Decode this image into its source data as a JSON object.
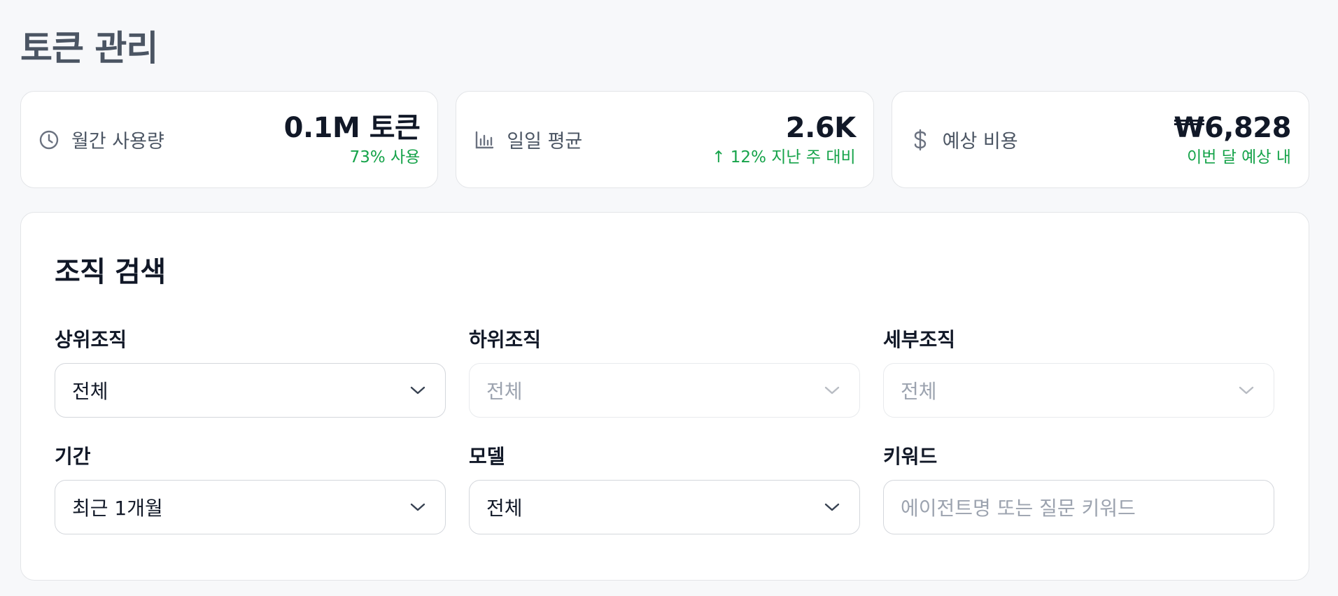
{
  "page": {
    "title": "토큰 관리"
  },
  "stats": [
    {
      "icon": "clock-icon",
      "label": "월간 사용량",
      "value": "0.1M 토큰",
      "sub": "73% 사용"
    },
    {
      "icon": "bar-chart-icon",
      "label": "일일 평균",
      "value": "2.6K",
      "sub": "↑ 12% 지난 주 대비"
    },
    {
      "icon": "dollar-icon",
      "label": "예상 비용",
      "value": "₩6,828",
      "sub": "이번 달 예상 내"
    }
  ],
  "colors": {
    "positive": "#16a34a",
    "title": "#4b5563"
  },
  "search": {
    "title": "조직 검색",
    "fields": {
      "upper_org": {
        "label": "상위조직",
        "value": "전체",
        "disabled": false
      },
      "lower_org": {
        "label": "하위조직",
        "value": "전체",
        "disabled": true
      },
      "detail_org": {
        "label": "세부조직",
        "value": "전체",
        "disabled": true
      },
      "period": {
        "label": "기간",
        "value": "최근 1개월",
        "disabled": false
      },
      "model": {
        "label": "모델",
        "value": "전체",
        "disabled": false
      },
      "keyword": {
        "label": "키워드",
        "placeholder": "에이전트명 또는 질문 키워드",
        "value": ""
      }
    }
  }
}
